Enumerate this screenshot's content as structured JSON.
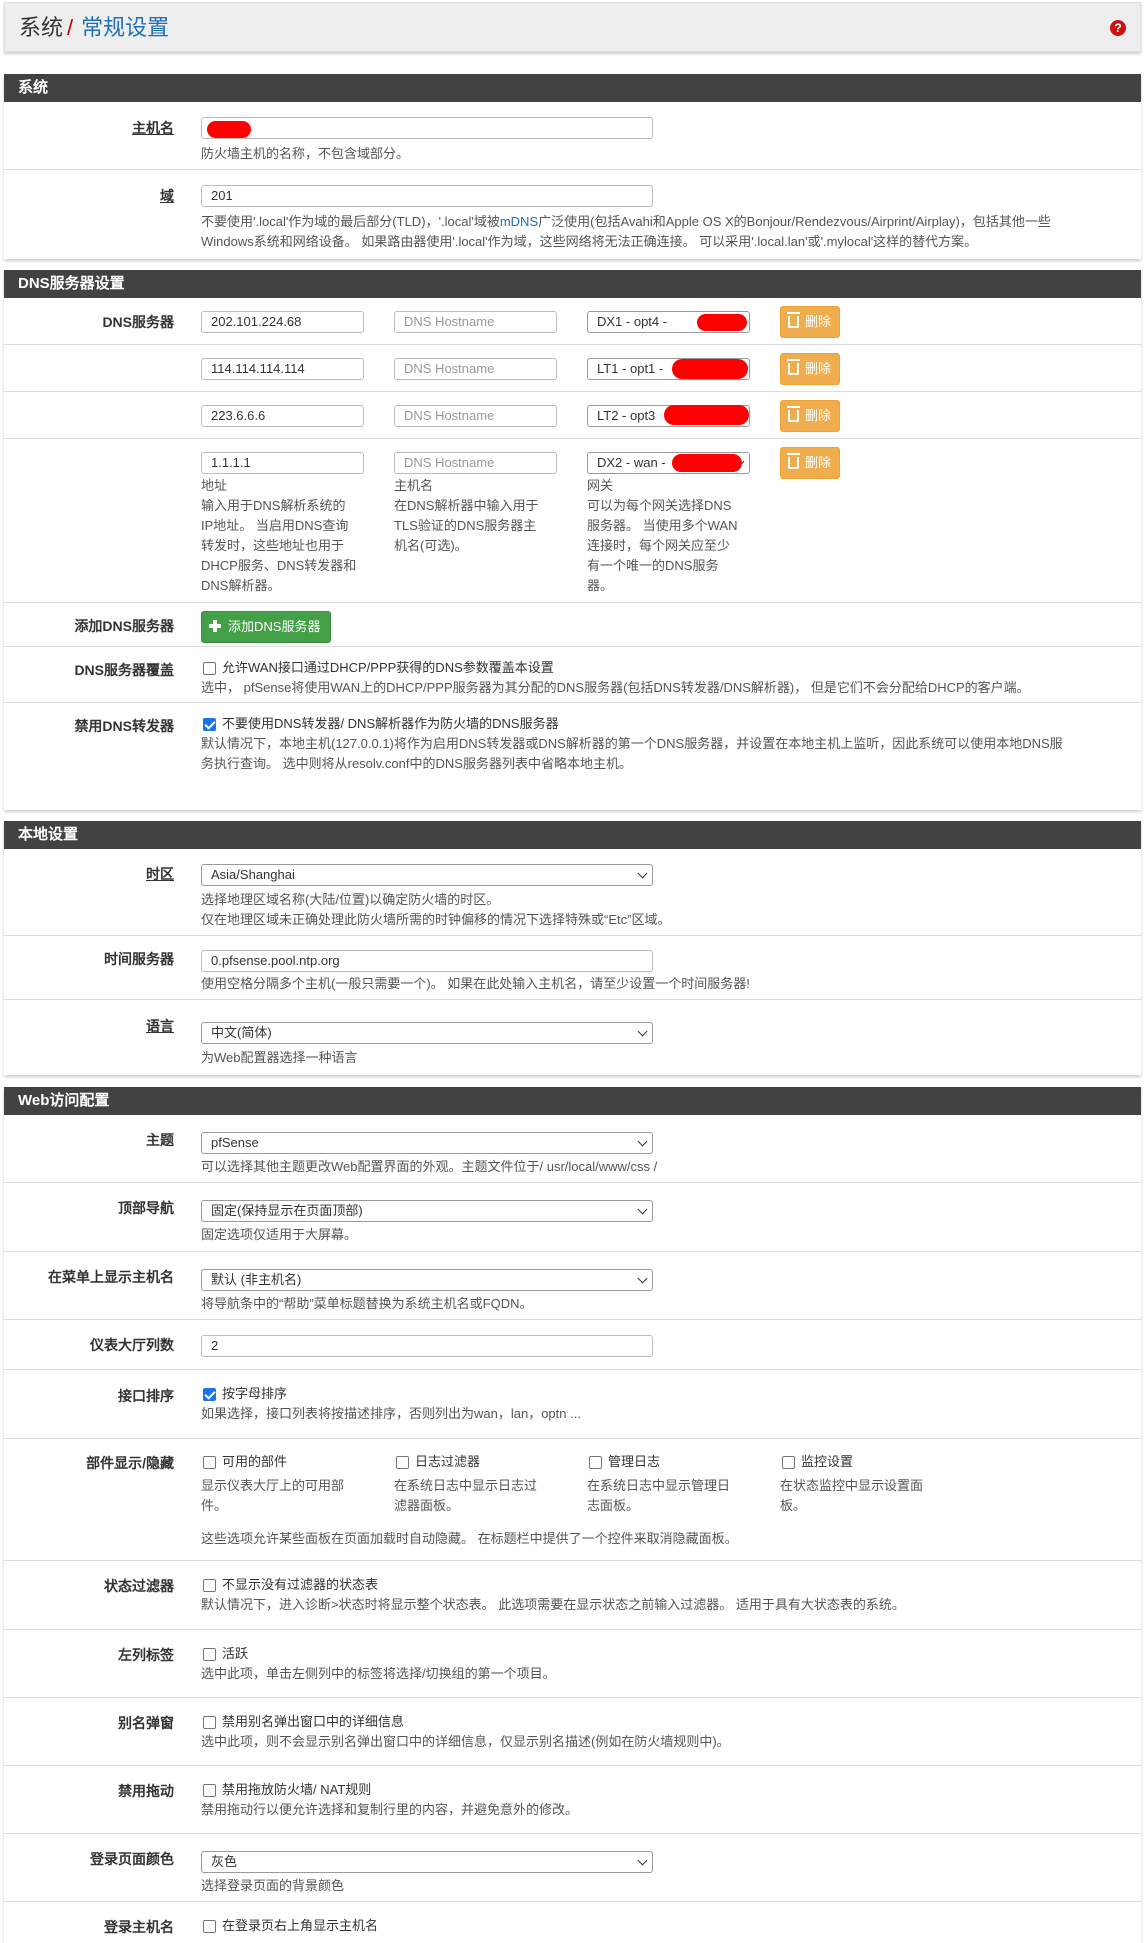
{
  "header": {
    "crumb_system": "系统",
    "crumb_sep": "/",
    "crumb_page": "常规设置",
    "help_icon": "?"
  },
  "panels": {
    "system": "系统",
    "dns": "DNS服务器设置",
    "local": "本地设置",
    "web": "Web访问配置"
  },
  "system": {
    "hostname_label": "主机名",
    "hostname_help": "防火墙主机的名称，不包含域部分。",
    "domain_label": "域",
    "domain_value": "201",
    "domain_help_1a": "不要使用'.local'作为域的最后部分(TLD)，'.local'域被",
    "domain_help_1_link": "mDNS",
    "domain_help_1b": "广泛使用(包括Avahi和Apple OS X的Bonjour/Rendezvous/Airprint/Airplay)，包括其他一些",
    "domain_help_2": "Windows系统和网络设备。 如果路由器使用'.local'作为域，这些网络将无法正确连接。 可以采用'.local.lan'或'.mylocal'这样的替代方案。"
  },
  "dns": {
    "servers_label": "DNS服务器",
    "hostname_placeholder": "DNS Hostname",
    "delete_label": "删除",
    "servers": [
      {
        "ip": "202.101.224.68",
        "gateway": "DX1 - opt4 -"
      },
      {
        "ip": "114.114.114.114",
        "gateway": "LT1 - opt1 -"
      },
      {
        "ip": "223.6.6.6",
        "gateway": "LT2 - opt3"
      },
      {
        "ip": "1.1.1.1",
        "gateway": "DX2 - wan -"
      }
    ],
    "col_help_addr": [
      "地址",
      "输入用于DNS解析系统的",
      "IP地址。 当启用DNS查询",
      "转发时，这些地址也用于",
      "DHCP服务、DNS转发器和",
      "DNS解析器。"
    ],
    "col_help_host": [
      "主机名",
      "在DNS解析器中输入用于",
      "TLS验证的DNS服务器主",
      "机名(可选)。"
    ],
    "col_help_gw": [
      "网关",
      "可以为每个网关选择DNS",
      "服务器。 当使用多个WAN",
      "连接时，每个网关应至少",
      "有一个唯一的DNS服务",
      "器。"
    ],
    "add_label": "添加DNS服务器",
    "add_button": "添加DNS服务器",
    "override_label": "DNS服务器覆盖",
    "override_cb": "允许WAN接口通过DHCP/PPP获得的DNS参数覆盖本设置",
    "override_help": "选中， pfSense将使用WAN上的DHCP/PPP服务器为其分配的DNS服务器(包括DNS转发器/DNS解析器)， 但是它们不会分配给DHCP的客户端。",
    "disable_fwd_label": "禁用DNS转发器",
    "disable_fwd_cb": "不要使用DNS转发器/ DNS解析器作为防火墙的DNS服务器",
    "disable_fwd_help_1": "默认情况下，本地主机(127.0.0.1)将作为启用DNS转发器或DNS解析器的第一个DNS服务器，并设置在本地主机上监听，因此系统可以使用本地DNS服",
    "disable_fwd_help_2": "务执行查询。 选中则将从resolv.conf中的DNS服务器列表中省略本地主机。"
  },
  "local": {
    "tz_label": "时区",
    "tz_value": "Asia/Shanghai",
    "tz_help_1": "选择地理区域名称(大陆/位置)以确定防火墙的时区。",
    "tz_help_2": "仅在地理区域未正确处理此防火墙所需的时钟偏移的情况下选择特殊或“Etc”区域。",
    "ntp_label": "时间服务器",
    "ntp_value": "0.pfsense.pool.ntp.org",
    "ntp_help": "使用空格分隔多个主机(一般只需要一个)。 如果在此处输入主机名，请至少设置一个时间服务器!",
    "lang_label": "语言",
    "lang_value": "中文(简体)",
    "lang_help": "为Web配置器选择一种语言"
  },
  "web": {
    "theme_label": "主题",
    "theme_value": "pfSense",
    "theme_help": "可以选择其他主题更改Web配置界面的外观。主题文件位于/ usr/local/www/css /",
    "topnav_label": "顶部导航",
    "topnav_value": "固定(保持显示在页面顶部)",
    "topnav_help": "固定选项仅适用于大屏幕。",
    "menuhost_label": "在菜单上显示主机名",
    "menuhost_value": "默认 (非主机名)",
    "menuhost_help": "将导航条中的“帮助”菜单标题替换为系统主机名或FQDN。",
    "cols_label": "仪表大厅列数",
    "cols_value": "2",
    "ifsort_label": "接口排序",
    "ifsort_cb": "按字母排序",
    "ifsort_help": "如果选择，接口列表将按描述排序，否则列出为wan，lan，optn ...",
    "widgets_label": "部件显示/隐藏",
    "widgets": [
      {
        "cb": "可用的部件",
        "help": [
          "显示仪表大厅上的可用部",
          "件。"
        ]
      },
      {
        "cb": "日志过滤器",
        "help": [
          "在系统日志中显示日志过",
          "滤器面板。"
        ]
      },
      {
        "cb": "管理日志",
        "help": [
          "在系统日志中显示管理日",
          "志面板。"
        ]
      },
      {
        "cb": "监控设置",
        "help": [
          "在状态监控中显示设置面",
          "板。"
        ]
      }
    ],
    "widgets_help": "这些选项允许某些面板在页面加载时自动隐藏。 在标题栏中提供了一个控件来取消隐藏面板。",
    "statefilter_label": "状态过滤器",
    "statefilter_cb": "不显示没有过滤器的状态表",
    "statefilter_help": "默认情况下，进入诊断>状态时将显示整个状态表。 此选项需要在显示状态之前输入过滤器。 适用于具有大状态表的系统。",
    "leftcol_label": "左列标签",
    "leftcol_cb": "活跃",
    "leftcol_help": "选中此项，单击左侧列中的标签将选择/切换组的第一个项目。",
    "alias_label": "别名弹窗",
    "alias_cb": "禁用别名弹出窗口中的详细信息",
    "alias_help": "选中此项，则不会显示别名弹出窗口中的详细信息，仅显示别名描述(例如在防火墙规则中)。",
    "drag_label": "禁用拖动",
    "drag_cb": "禁用拖放防火墙/ NAT规则",
    "drag_help": "禁用拖动行以便允许选择和复制行里的内容，并避免意外的修改。",
    "logincolor_label": "登录页面颜色",
    "logincolor_value": "灰色",
    "logincolor_help": "选择登录页面的背景颜色",
    "loginhost_label": "登录主机名",
    "loginhost_cb": "在登录页右上角显示主机名"
  },
  "colors": {
    "header_bg": "#424242",
    "link": "#1e6fb5",
    "delete_btn": "#f0ad4e",
    "add_btn": "#43a047",
    "redaction": "#ff0000"
  }
}
